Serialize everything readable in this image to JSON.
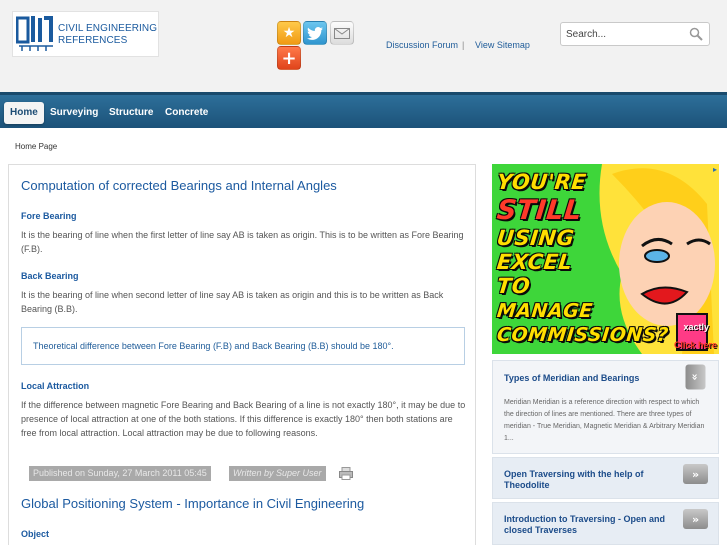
{
  "header": {
    "logo_line1": "CIVIL ENGINEERING",
    "logo_line2": "REFERENCES",
    "share_icons": [
      "star-icon",
      "twitter-icon",
      "mail-icon",
      "plus-icon"
    ],
    "links": {
      "forum": "Discussion Forum",
      "separator": "|",
      "sitemap": "View Sitemap"
    },
    "search_placeholder": "Search..."
  },
  "nav": {
    "items": [
      {
        "label": "Home",
        "active": true
      },
      {
        "label": "Surveying",
        "active": false
      },
      {
        "label": "Structure",
        "active": false
      },
      {
        "label": "Concrete",
        "active": false
      }
    ]
  },
  "breadcrumb": "Home Page",
  "article": {
    "title": "Computation of corrected Bearings and Internal Angles",
    "sections": [
      {
        "heading": "Fore Bearing",
        "text": "It is the bearing of line when the first letter of line say AB is taken as origin. This is to be written as Fore Bearing (F.B)."
      },
      {
        "heading": "Back Bearing",
        "text": "It is the bearing of line when second letter of line say AB is taken as origin and this is to be written as Back Bearing (B.B)."
      },
      {
        "heading": "Local Attraction",
        "text": "If the difference between magnetic Fore Bearing and Back Bearing of a line is not exactly 180°, it may be due to presence of local attraction at one of the both stations. If this difference is exactly 180° then both stations are free from local attraction. Local attraction may be due to following reasons."
      }
    ],
    "note": "Theoretical difference between Fore Bearing (F.B) and Back Bearing (B.B) should be 180°.",
    "published": "Published on Sunday, 27 March 2011 05:45",
    "author": "Written by Super User",
    "print_icon": "print-icon"
  },
  "article2": {
    "title": "Global Positioning System - Importance in Civil Engineering",
    "first_heading": "Object"
  },
  "ad": {
    "lines": [
      "YOU'RE",
      "STILL",
      "USING",
      "EXCEL",
      "TO",
      "MANAGE",
      "COMMISSIONS?"
    ],
    "brand": "xactly",
    "cta": "Click here"
  },
  "sidebar": {
    "panels": [
      {
        "title": "Types of Meridian and Bearings",
        "desc": "Meridian Meridian is a reference direction with respect to which the direction of lines are mentioned. There are three types of meridian - True Meridian, Magnetic Meridian & Arbitrary Meridian 1...",
        "toggle": "»",
        "expanded": true
      },
      {
        "title": "Open Traversing with the help of Theodolite",
        "toggle": "»",
        "expanded": false
      },
      {
        "title": "Introduction to Traversing - Open and closed Traverses",
        "toggle": "»",
        "expanded": false
      }
    ]
  }
}
